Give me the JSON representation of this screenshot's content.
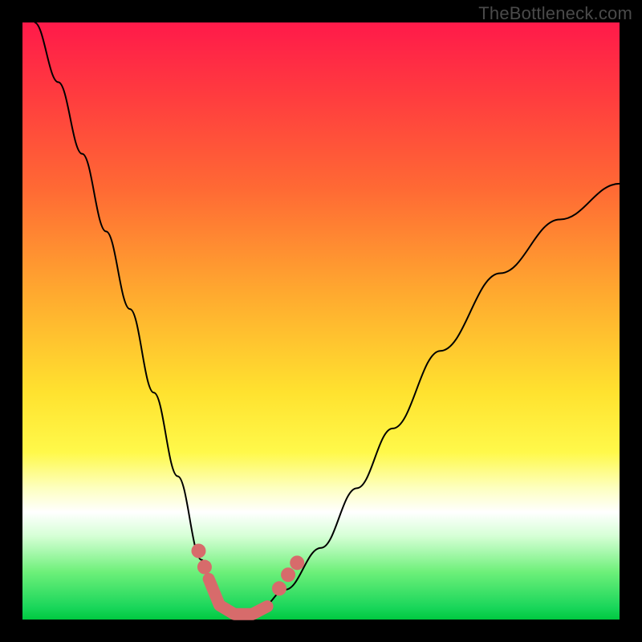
{
  "watermark": "TheBottleneck.com",
  "chart_data": {
    "type": "line",
    "title": "",
    "xlabel": "",
    "ylabel": "",
    "xlim": [
      0,
      1
    ],
    "ylim": [
      0,
      1
    ],
    "legend": false,
    "grid": false,
    "background": "rainbow-gradient-red-to-green",
    "series": [
      {
        "name": "bottleneck-curve",
        "x": [
          0.02,
          0.06,
          0.1,
          0.14,
          0.18,
          0.22,
          0.26,
          0.3,
          0.32,
          0.34,
          0.36,
          0.38,
          0.4,
          0.44,
          0.5,
          0.56,
          0.62,
          0.7,
          0.8,
          0.9,
          1.0
        ],
        "y": [
          1.0,
          0.9,
          0.78,
          0.65,
          0.52,
          0.38,
          0.24,
          0.1,
          0.05,
          0.02,
          0.01,
          0.01,
          0.02,
          0.05,
          0.12,
          0.22,
          0.32,
          0.45,
          0.58,
          0.67,
          0.73
        ]
      }
    ],
    "markers": {
      "name": "optimal-region",
      "color": "#d76b6b",
      "left_dots": [
        {
          "x": 0.295,
          "y": 0.115
        },
        {
          "x": 0.305,
          "y": 0.088
        }
      ],
      "right_dots": [
        {
          "x": 0.43,
          "y": 0.052
        },
        {
          "x": 0.445,
          "y": 0.075
        },
        {
          "x": 0.46,
          "y": 0.095
        }
      ],
      "bottom_path": [
        {
          "x": 0.312,
          "y": 0.068
        },
        {
          "x": 0.33,
          "y": 0.024
        },
        {
          "x": 0.355,
          "y": 0.009
        },
        {
          "x": 0.385,
          "y": 0.009
        },
        {
          "x": 0.41,
          "y": 0.022
        }
      ]
    }
  }
}
